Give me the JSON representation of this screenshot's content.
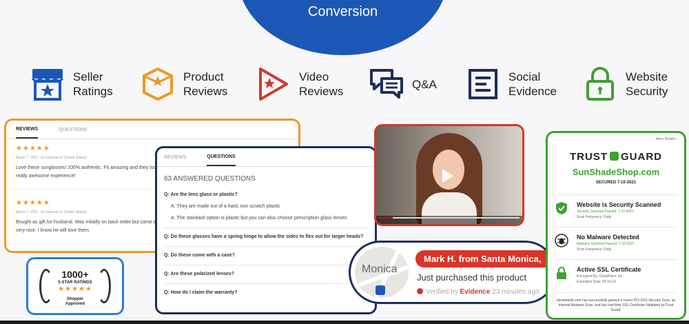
{
  "banner": {
    "title": "Conversion"
  },
  "features": [
    {
      "icon": "store-icon",
      "line1": "Seller",
      "line2": "Ratings",
      "color": "#1b58b6"
    },
    {
      "icon": "box-star-icon",
      "line1": "Product",
      "line2": "Reviews",
      "color": "#f29526"
    },
    {
      "icon": "play-star-icon",
      "line1": "Video",
      "line2": "Reviews",
      "color": "#d0392b"
    },
    {
      "icon": "chat-bubbles-icon",
      "line1": "Q&A",
      "line2": "",
      "color": "#1d2d5c"
    },
    {
      "icon": "document-icon",
      "line1": "Social",
      "line2": "Evidence",
      "color": "#1d2d5c"
    },
    {
      "icon": "lock-icon",
      "line1": "Website",
      "line2": "Security",
      "color": "#3fa132"
    }
  ],
  "reviews_card": {
    "tab_reviews": "REVIEWS",
    "tab_questions": "QUESTIONS",
    "reviews": [
      {
        "stars": "★★★★★",
        "meta": "March 7, 2021 · by Donovan E (United States)",
        "text": "Love these sunglasses! 100% authentic. Fit amazing and they look s really awesome experience!"
      },
      {
        "stars": "★★★★★",
        "meta": "March 7, 2021 · by Donovan E (United States)",
        "text": "Bought as gift for husband. Was initially on back order but came ava very nice. I know he will love them."
      }
    ]
  },
  "qa_card": {
    "tab_reviews": "REVIEWS",
    "tab_questions": "QUESTIONS",
    "count": "63 ANSWERED QUESTIONS",
    "q1": "Q: Are the lens glass or plastic?",
    "a1": "A: They are made out of a hard, non scratch plastic",
    "a2": "A: The standard option is plastic but you can also choose prescription glass lenses",
    "q2": "Q: Do these glasses have a spring hinge to allow the sides to flex out for larger heads?",
    "q3": "Q: Do these come with a case?",
    "q4": "Q: Are these polarized lenses?",
    "q5": "Q: How do I claim the warranty?"
  },
  "notification": {
    "map_text": "Monica",
    "name": "Mark H. from Santa Monica, CA",
    "message": "Just purchased this product",
    "verified_by": "Verified by",
    "evidence": "Evidence",
    "time": "23 minutes ago"
  },
  "badge": {
    "count": "1000+",
    "label": "5-STAR RATINGS",
    "stars": "★★★★★",
    "brand1": "Shopper",
    "brand2": "Approved"
  },
  "trust": {
    "more": "More Details ›",
    "logo_left": "TRUST",
    "logo_right": "GUARD",
    "site": "SunShadeShop.com",
    "secured": "SECURED 7-10-2021",
    "items": [
      {
        "title": "Website is Security Scanned",
        "sub1": "Security Scanned Passed: 7-10-2021",
        "sub2": "Scan Frequency: Daily"
      },
      {
        "title": "No Malware Detected",
        "sub1": "Malware Scanned Passed: 7-10-2021",
        "sub2": "Scan Frequency: Daily"
      },
      {
        "title": "Active SSL Certificate",
        "sub1": "Encrypted By: CloudFlare, Inc.",
        "sub2": "Expiration Date: 04-16-22"
      }
    ],
    "footer": "abcwebsite.com has successfully passed a recent PCI DSS Security Scan, an Internal Malware Scan, and has had their SSL Certificate Validated by Trust Guard."
  }
}
